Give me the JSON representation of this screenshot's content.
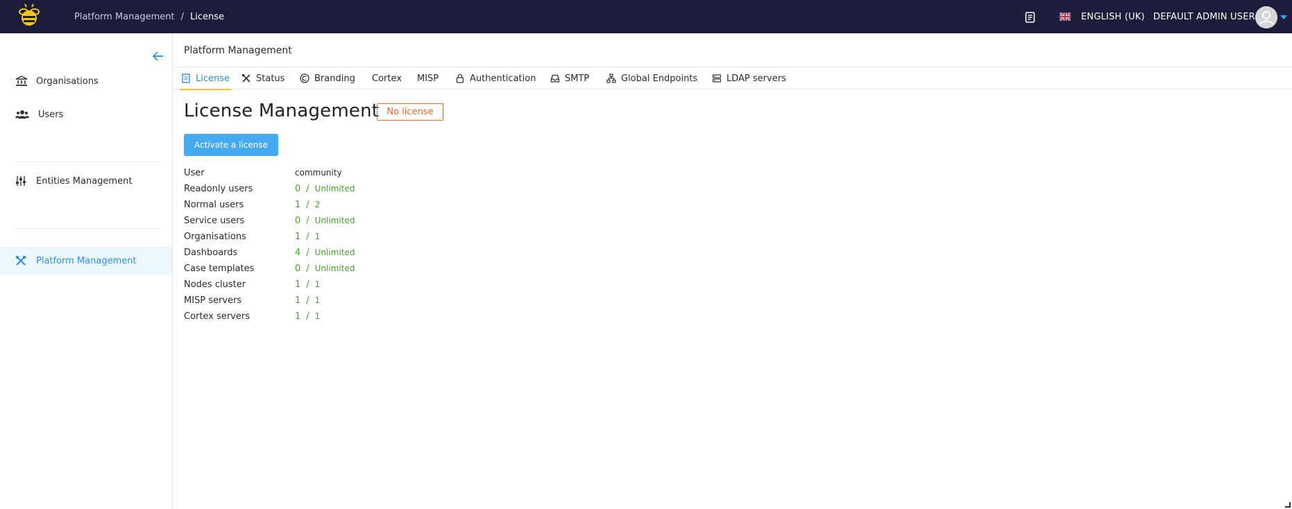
{
  "header": {
    "breadcrumb": [
      "Platform Management",
      "License"
    ],
    "breadcrumb_separator": "/",
    "language": "ENGLISH (UK)",
    "user": "DEFAULT ADMIN USER",
    "icons": {
      "docs": "document-icon",
      "flag": "uk-flag-icon",
      "avatar": "avatar-icon",
      "menu": "caret-down-icon"
    },
    "colors": {
      "bar": "#1c1d3a",
      "logo": "#f5c518"
    }
  },
  "sidebar": {
    "items": [
      {
        "label": "Organisations",
        "icon": "bank-icon"
      },
      {
        "label": "Users",
        "icon": "users-icon"
      },
      {
        "label": "Entities Management",
        "icon": "sliders-icon"
      },
      {
        "label": "Platform Management",
        "icon": "tools-icon",
        "active": true
      }
    ]
  },
  "main": {
    "title": "Platform Management",
    "tabs": [
      {
        "label": "License",
        "icon": "license-icon",
        "active": true
      },
      {
        "label": "Status",
        "icon": "tools-icon"
      },
      {
        "label": "Branding",
        "icon": "copyright-icon"
      },
      {
        "label": "Cortex",
        "icon": ""
      },
      {
        "label": "MISP",
        "icon": ""
      },
      {
        "label": "Authentication",
        "icon": "lock-icon"
      },
      {
        "label": "SMTP",
        "icon": "inbox-icon"
      },
      {
        "label": "Global Endpoints",
        "icon": "network-icon"
      },
      {
        "label": "LDAP servers",
        "icon": "server-icon"
      }
    ],
    "heading": "License Management",
    "status_badge": "No license",
    "activate_button": "Activate a license",
    "license": {
      "user_label": "User",
      "user_value": "community",
      "rows": [
        {
          "label": "Readonly users",
          "used": "0",
          "limit": "Unlimited"
        },
        {
          "label": "Normal users",
          "used": "1",
          "limit": "2"
        },
        {
          "label": "Service users",
          "used": "0",
          "limit": "Unlimited"
        },
        {
          "label": "Organisations",
          "used": "1",
          "limit": "1"
        },
        {
          "label": "Dashboards",
          "used": "4",
          "limit": "Unlimited"
        },
        {
          "label": "Case templates",
          "used": "0",
          "limit": "Unlimited"
        },
        {
          "label": "Nodes cluster",
          "used": "1",
          "limit": "1"
        },
        {
          "label": "MISP servers",
          "used": "1",
          "limit": "1"
        },
        {
          "label": "Cortex servers",
          "used": "1",
          "limit": "1"
        }
      ],
      "separator": "/"
    },
    "colors": {
      "accent": "#2e8ee0",
      "tab_underline": "#f0c02a",
      "badge": "#f0622a",
      "ok": "#47a32a",
      "button": "#45aaf2"
    }
  }
}
